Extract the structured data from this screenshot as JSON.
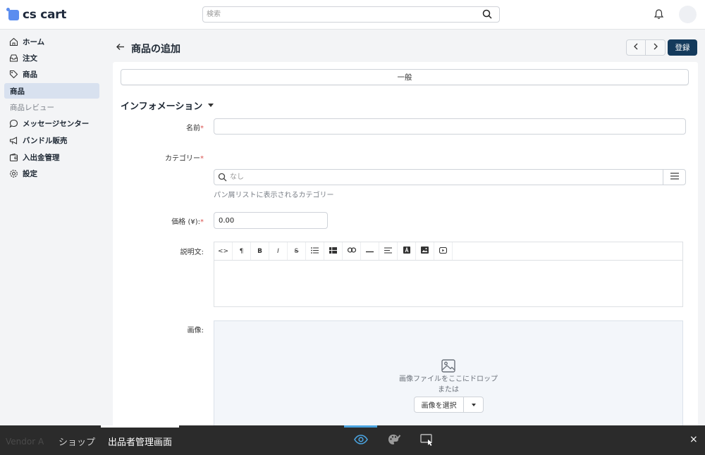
{
  "header": {
    "logo_text": "cs cart",
    "search_placeholder": "検索"
  },
  "sidebar": {
    "items": [
      {
        "label": "ホーム",
        "icon": "home-icon"
      },
      {
        "label": "注文",
        "icon": "inbox-icon"
      },
      {
        "label": "商品",
        "icon": "tag-icon"
      },
      {
        "label": "商品",
        "icon": "",
        "active": true
      },
      {
        "label": "商品レビュー",
        "icon": "",
        "sub": true
      },
      {
        "label": "メッセージセンター",
        "icon": "chat-icon"
      },
      {
        "label": "バンドル販売",
        "icon": "megaphone-icon"
      },
      {
        "label": "入出金管理",
        "icon": "wallet-icon"
      },
      {
        "label": "設定",
        "icon": "gear-icon"
      }
    ]
  },
  "page": {
    "title": "商品の追加",
    "save_label": "登録"
  },
  "tabs": {
    "general": "一般"
  },
  "form": {
    "section_title": "インフォメーション",
    "name_label": "名前",
    "name_value": "",
    "category_label": "カテゴリー",
    "category_placeholder": "なし",
    "category_hint": "パン屑リストに表示されるカテゴリー",
    "price_label": "価格 (¥):",
    "price_value": "0.00",
    "description_label": "説明文:",
    "toolbar_buttons": [
      "code-view",
      "paragraph",
      "bold",
      "italic",
      "strikethrough",
      "unordered-list",
      "table",
      "link",
      "horizontal-rule",
      "align",
      "font-color",
      "image",
      "video"
    ],
    "image_label": "画像:",
    "dropzone_text": "画像ファイルをここにドロップ",
    "dropzone_or": "または",
    "dropzone_button": "画像を選択",
    "required_mark": "*"
  },
  "bottombar": {
    "vendor_text": "Vendor A",
    "shop_label": "ショップ",
    "admin_label": "出品者管理画面",
    "close_label": "×"
  },
  "colors": {
    "primary_button": "#143a5c",
    "active_sidebar": "#d8e1ef",
    "required": "#d9534f",
    "accent_blue": "#4aa3df"
  }
}
